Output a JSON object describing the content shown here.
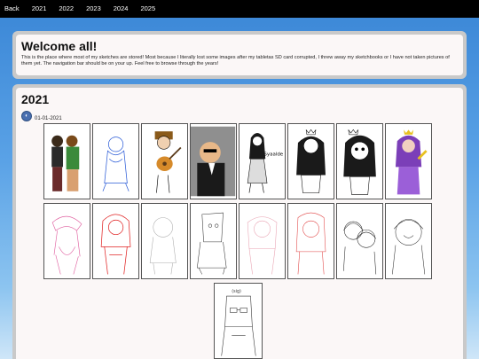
{
  "nav": {
    "items": [
      "Back",
      "2021",
      "2022",
      "2023",
      "2024",
      "2025"
    ]
  },
  "welcome": {
    "title": "Welcome all!",
    "text": "This is the place where most of my sketches are stored! Most because I literally lost some images after my tabletas SD card corrupted, I threw away my sketchbooks or I have not taken pictures of them yet. The navigation bar should be on your up. Feel free to browse through the years!"
  },
  "year_section": {
    "title": "2021",
    "date": "01-01-2021"
  },
  "gallery": {
    "row1": [
      "colored-duo",
      "blue-sketch",
      "guitar-player",
      "bald-man",
      "girl-syaalde",
      "girl-crown",
      "girl-crown-2",
      "purple-girl"
    ],
    "row2": [
      "pink-sketch",
      "red-sketch",
      "faint-sketch",
      "line-sketch",
      "faint-pink",
      "red-outline",
      "duo-sketch",
      "smiling-girl"
    ],
    "row3": [
      "glasses-girl"
    ],
    "colors": {
      "blue": "#2a5bd7",
      "red": "#e02020",
      "pink": "#e060a0",
      "purple": "#7b3fb8"
    }
  }
}
